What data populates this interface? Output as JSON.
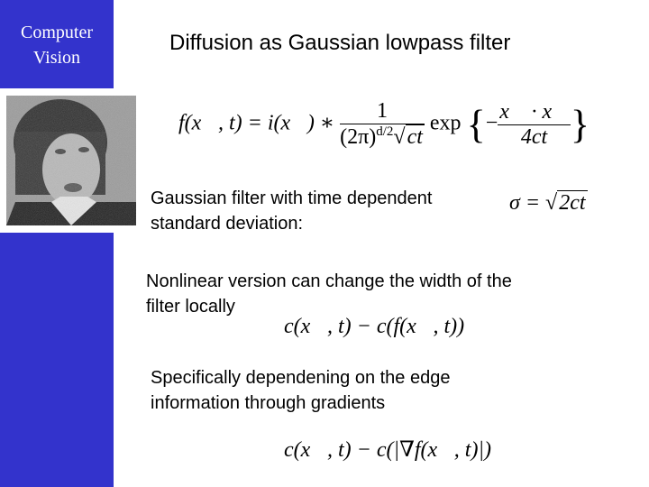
{
  "sidebar": {
    "course_line1": "Computer",
    "course_line2": "Vision",
    "color": "#3333cc"
  },
  "photo": {
    "description": "grayscale noisy portrait of a woman"
  },
  "title": "Diffusion as Gaussian lowpass filter",
  "equations": {
    "gaussian": {
      "lhs": "f(x⃗, t) = i(x⃗) ∗",
      "num": "1",
      "den_pre": "(2π)",
      "den_exp": "d/2",
      "den_sqrt": "ct",
      "exp": "exp",
      "inner_num": "x⃗ · x⃗",
      "inner_den": "4ct"
    },
    "sigma": {
      "lhs": "σ = √",
      "rad": "2ct"
    },
    "nonlinear": "c(x⃗, t) − c(f(x⃗, t))",
    "gradient": "c(x⃗, t) − c(|∇f(x⃗, t)|)"
  },
  "text": {
    "p1_line1": "Gaussian filter with time dependent",
    "p1_line2": "standard deviation:",
    "p2_line1": "Nonlinear version can change the width of the",
    "p2_line2": "filter locally",
    "p3_line1": "Specifically dependening on the edge",
    "p3_line2": "information through gradients"
  }
}
